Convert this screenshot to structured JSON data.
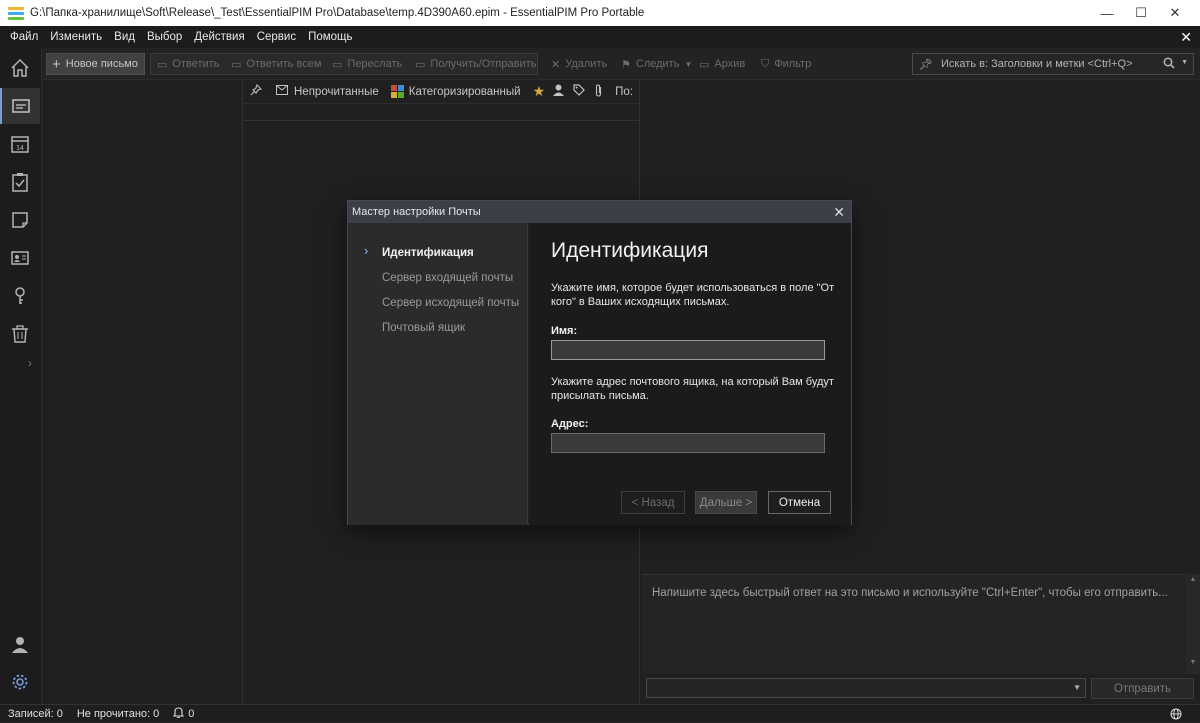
{
  "window": {
    "title": "G:\\Папка-хранилище\\Soft\\Release\\_Test\\EssentialPIM Pro\\Database\\temp.4D390A60.epim - EssentialPIM Pro Portable",
    "minimize": "—",
    "maximize": "☐",
    "close": "✕"
  },
  "menu": [
    "Файл",
    "Изменить",
    "Вид",
    "Выбор",
    "Действия",
    "Сервис",
    "Помощь"
  ],
  "toolbar": {
    "new_mail": "Новое письмо",
    "reply": "Ответить",
    "reply_all": "Ответить всем",
    "forward": "Переслать",
    "send_receive": "Получить/Отправить",
    "delete": "Удалить",
    "follow": "Следить",
    "archive": "Архив",
    "filter": "Фильтр",
    "search_label": "Искать в: Заголовки и метки <Ctrl+Q>"
  },
  "list_filters": {
    "unread": "Непрочитанные",
    "categorized": "Категоризированный",
    "by": "По:"
  },
  "quick_reply": {
    "placeholder": "Напишите здесь быстрый ответ на это письмо и используйте \"Ctrl+Enter\", чтобы его отправить...",
    "send": "Отправить"
  },
  "status": {
    "records": "Записей: 0",
    "unread": "Не прочитано: 0",
    "reminders": "0"
  },
  "dialog": {
    "title": "Мастер настройки Почты",
    "steps": [
      {
        "label": "Идентификация",
        "active": true
      },
      {
        "label": "Сервер входящей почты",
        "active": false
      },
      {
        "label": "Сервер исходящей почты",
        "active": false
      },
      {
        "label": "Почтовый ящик",
        "active": false
      }
    ],
    "heading": "Идентификация",
    "name_desc": "Укажите имя, которое будет использоваться в поле \"От кого\" в Ваших исходящих письмах.",
    "name_label": "Имя:",
    "name_value": "",
    "address_desc": "Укажите адрес почтового ящика, на который Вам будут присылать письма.",
    "address_label": "Адрес:",
    "address_value": "",
    "back": "< Назад",
    "next": "Дальше >",
    "cancel": "Отмена"
  },
  "colors": {
    "accent": "#8ab4f8",
    "background": "#252525",
    "dialog_title_bg": "#3a3f48",
    "star": "#f2c744"
  }
}
